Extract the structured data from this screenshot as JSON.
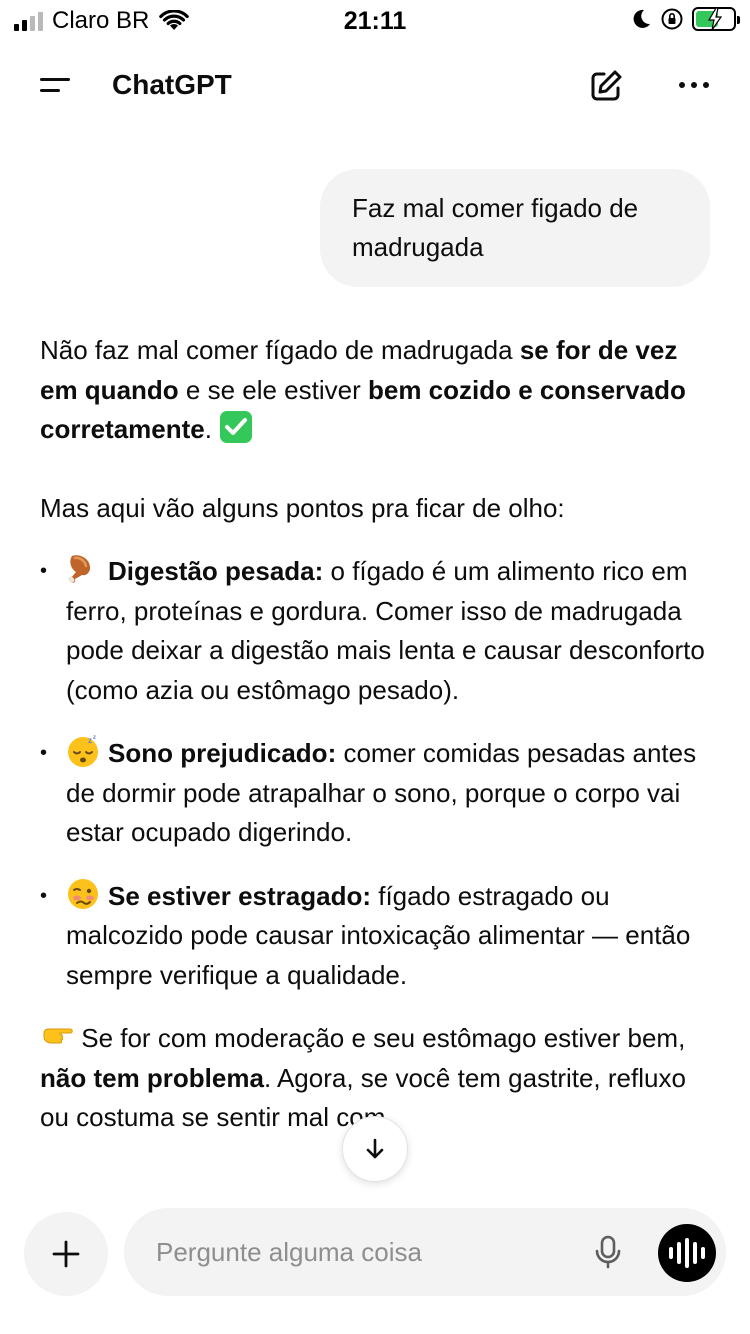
{
  "status_bar": {
    "carrier": "Claro BR",
    "time": "21:11"
  },
  "header": {
    "title": "ChatGPT"
  },
  "conversation": {
    "user_message": "Faz mal comer figado de madrugada",
    "intro": {
      "t1": "Não faz mal comer fígado de madrugada ",
      "b1": "se for de vez em quando",
      "t2": " e se ele estiver ",
      "b2": "bem cozido e conservado corretamente",
      "t3": ". "
    },
    "lead": "Mas aqui vão alguns pontos pra ficar de olho:",
    "bullets": [
      {
        "icon": "drumstick-emoji",
        "title": "Digestão pesada:",
        "text": " o fígado é um alimento rico em ferro, proteínas e gordura. Comer isso de madrugada pode deixar a digestão mais lenta e causar desconforto (como azia ou estômago pesado)."
      },
      {
        "icon": "sleeping-face-emoji",
        "title": "Sono prejudicado:",
        "text": " comer comidas pesadas antes de dormir pode atrapalhar o sono, porque o corpo vai estar ocupado digerindo."
      },
      {
        "icon": "woozy-face-emoji",
        "title": "Se estiver estragado:",
        "text": " fígado estragado ou malcozido pode causar intoxicação alimentar — então sempre verifique a qualidade."
      }
    ],
    "closing": {
      "t1": " Se for com moderação e seu estômago estiver bem, ",
      "b1": "não tem problema",
      "t2": ". Agora, se você tem gastrite, refluxo ou costuma se sentir mal com"
    }
  },
  "composer": {
    "placeholder": "Pergunte alguma coisa"
  },
  "colors": {
    "bubble_bg": "#f3f3f3",
    "check_green": "#34c759",
    "text": "#0d0d0d",
    "placeholder": "#8e8e8e"
  },
  "icons": [
    "menu-icon",
    "new-chat-icon",
    "more-icon",
    "arrow-down-icon",
    "plus-icon",
    "microphone-icon",
    "voice-mode-icon",
    "check-mark-emoji",
    "pointing-right-emoji"
  ]
}
